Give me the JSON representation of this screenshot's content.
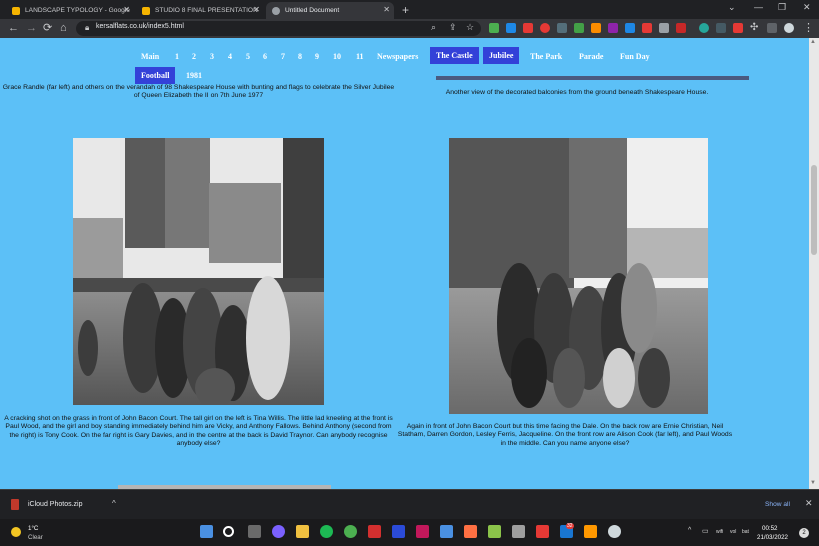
{
  "browser": {
    "tabs": [
      {
        "title": "LANDSCAPE TYPOLOGY - Google",
        "favicon_color": "#f6b400"
      },
      {
        "title": "STUDIO 8 FINAL PRESENTATION",
        "favicon_color": "#f6b400"
      },
      {
        "title": "Untitled Document",
        "favicon_color": "#9aa0a6"
      }
    ],
    "new_tab": "+",
    "window_controls": [
      "⌄",
      "—",
      "❐",
      "✕"
    ],
    "nav": {
      "back": "←",
      "forward": "→",
      "reload": "⟳",
      "home": "⌂"
    },
    "url": "kersalflats.co.uk/index5.html",
    "extension_colors": [
      "#4caf50",
      "#1e88e5",
      "#e53935",
      "#e53935",
      "#546e7a",
      "#43a047",
      "#fb8c00",
      "#8e24aa",
      "#1e88e5",
      "#e53935",
      "#9aa0a6",
      "#c62828",
      "#ffffff"
    ]
  },
  "site_nav": {
    "items": [
      "Main",
      "1",
      "2",
      "3",
      "4",
      "5",
      "6",
      "7",
      "8",
      "9",
      "10",
      "11",
      "Newspapers",
      "The Castle",
      "Jubilee",
      "The Park",
      "Parade",
      "Fun Day"
    ],
    "row2": [
      "Football",
      "1981"
    ],
    "selected_color": "#3341d8"
  },
  "content": {
    "caption_top_left": "Grace Randle (far left) and others on the verandah of 98 Shakespeare House with bunting and flags to celebrate the Silver Jubilee of Queen Elizabeth the II on 7th June 1977",
    "caption_top_right": "Another view of the decorated balconies from the ground beneath Shakespeare House.",
    "caption_left": "A cracking shot on the grass in front of John Bacon Court. The tall girl on the left is Tina Willis. The little lad kneeling at the front is Paul Wood, and the girl and boy standing immediately behind him are Vicky, and Anthony Fallows. Behind Anthony (second from the right) is Tony Cook. On the far right is Gary Davies, and in the centre at the back is David Traynor. Can anybody recognise anybody else?",
    "caption_right": "Again in front of John Bacon Court but this time facing the Dale. On the back row are Ernie Christian, Neil Statham, Darren Gordon, Lesley Ferris, Jacqueline. On the front row are Alison Cook (far left), and Paul Woods in the middle. Can you name anyone else?",
    "page_bg": "#5cc0f7"
  },
  "downloads_bar": {
    "file": "iCloud Photos.zip",
    "caret": "^",
    "show_all": "Show all",
    "close": "✕"
  },
  "taskbar": {
    "weather_temp": "1°C",
    "weather_cond": "Clear",
    "app_colors": [
      "#4a90e2",
      "#ffffff",
      "#6a6a6a",
      "#7b61ff",
      "#f0c040",
      "#1db954",
      "#4caf50",
      "#d32f2f",
      "#2b4bd8",
      "#c2185b",
      "#4a90e2",
      "#ff7043",
      "#8bc34a",
      "#9e9e9e",
      "#e53935",
      "#1976d2",
      "#ff9800",
      "#cfd8dc"
    ],
    "mail_badge": "32",
    "tray_icons": [
      "^",
      "▭",
      "wifi",
      "vol",
      "bat"
    ],
    "time": "00:52",
    "date": "21/03/2022",
    "notifications": "2"
  }
}
